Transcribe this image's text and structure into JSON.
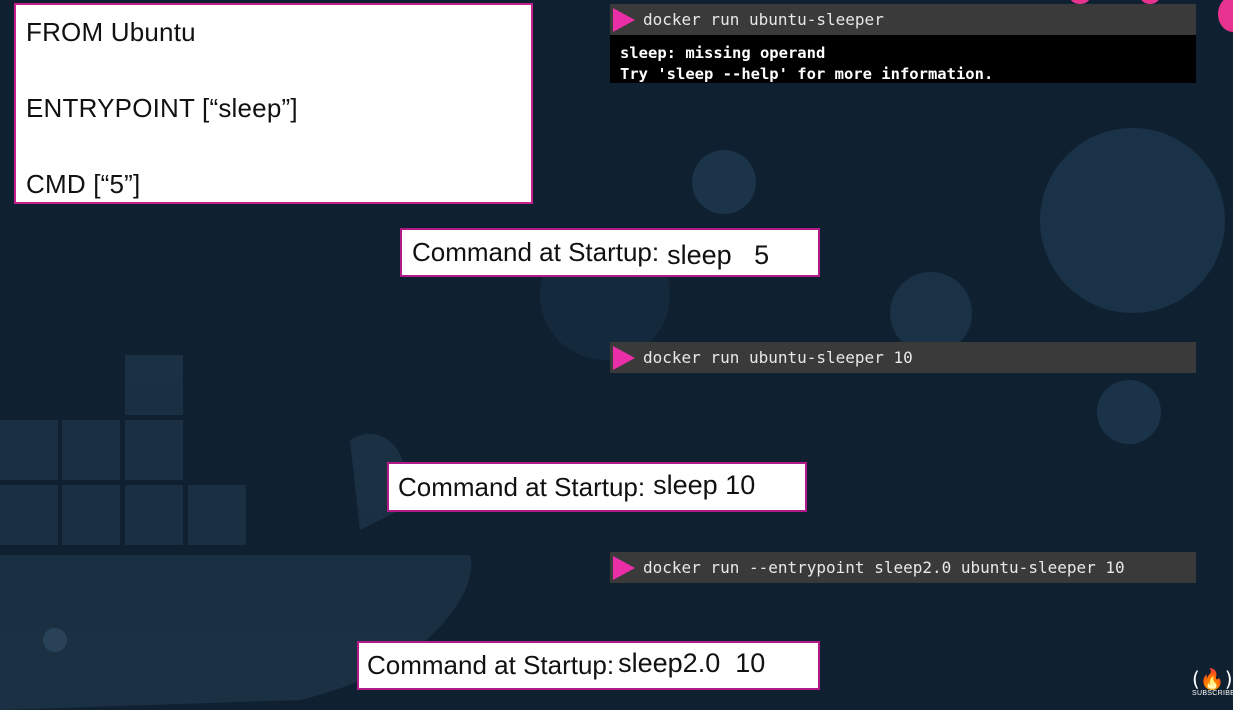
{
  "dockerfile": {
    "line1": "FROM Ubuntu",
    "line2": "ENTRYPOINT [“sleep”]",
    "line3": "CMD [“5”]"
  },
  "terminal1": {
    "command": "docker run ubuntu-sleeper",
    "output": [
      "sleep: missing operand",
      "Try 'sleep --help' for more information."
    ]
  },
  "terminal2": {
    "command": "docker run ubuntu-sleeper 10"
  },
  "terminal3": {
    "command": "docker run --entrypoint sleep2.0 ubuntu-sleeper 10"
  },
  "startup1": {
    "label": "Command at Startup:",
    "value": "sleep   5"
  },
  "startup2": {
    "label": "Command at Startup:",
    "value": "sleep 10"
  },
  "startup3": {
    "label": "Command at Startup:",
    "value": "sleep2.0  10"
  },
  "subscribe": {
    "icon": "(🔥)",
    "label": "SUBSCRIBE"
  },
  "colors": {
    "background": "#0f2131",
    "accent": "#ea2ea7",
    "terminal_bar": "#3a3a3a",
    "terminal_output": "#000000"
  }
}
